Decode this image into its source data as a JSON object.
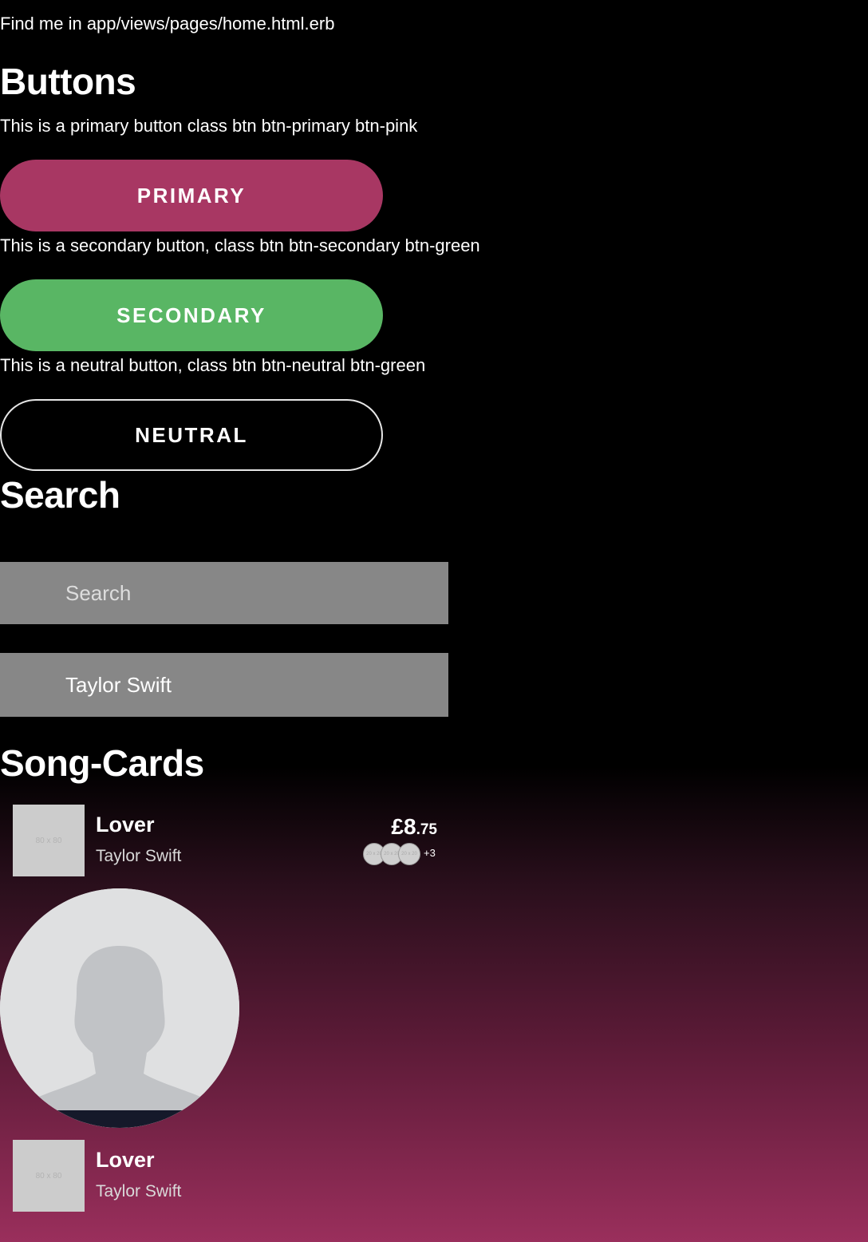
{
  "hint": "Find me in app/views/pages/home.html.erb",
  "buttons": {
    "heading": "Buttons",
    "primary_desc": "This is a primary button class btn btn-primary btn-pink",
    "primary_label": "PRIMARY",
    "secondary_desc": "This is a secondary button, class btn btn-secondary btn-green",
    "secondary_label": "SECONDARY",
    "neutral_desc": "This is a neutral button, class btn btn-neutral btn-green",
    "neutral_label": "NEUTRAL"
  },
  "search": {
    "heading": "Search",
    "placeholder": "Search",
    "filled_value": "Taylor Swift"
  },
  "song_cards": {
    "heading": "Song-Cards",
    "cards": [
      {
        "thumb_label": "80 x 80",
        "title": "Lover",
        "artist": "Taylor Swift",
        "price_major": "£8",
        "price_minor": ".75",
        "avatars": [
          "20 x 20",
          "20 x 20",
          "20 x 20"
        ],
        "more": "+3"
      },
      {
        "thumb_label": "80 x 80",
        "title": "Lover",
        "artist": "Taylor Swift"
      }
    ]
  },
  "colors": {
    "pink": "#a83763",
    "green": "#59b664",
    "search_bg": "#878787",
    "gradient_bottom": "#9a2f5c"
  },
  "icons": {
    "profile": "default-user-silhouette-icon"
  }
}
